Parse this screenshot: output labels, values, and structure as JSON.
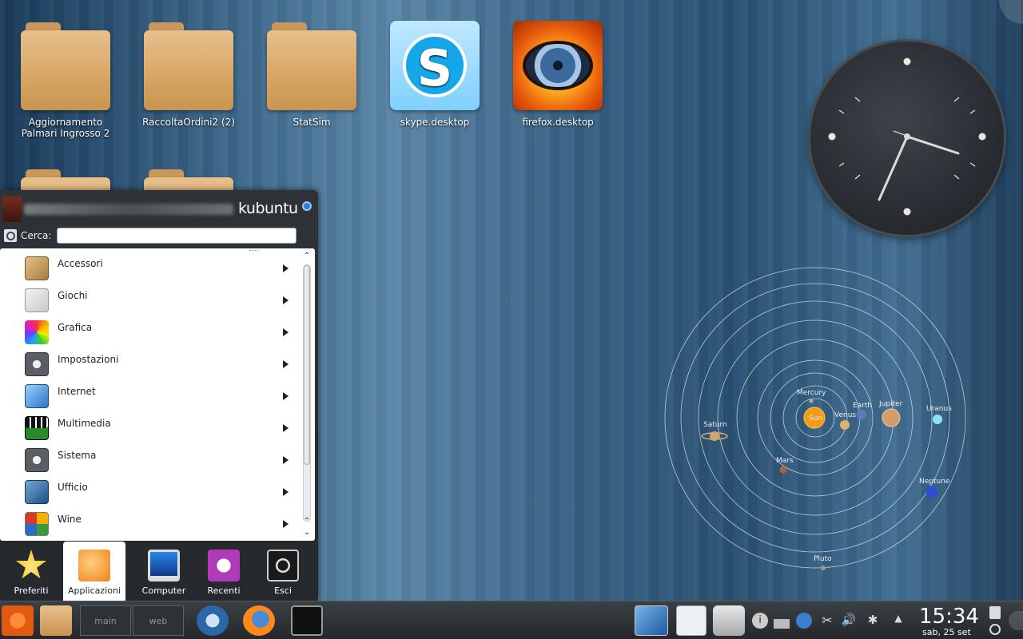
{
  "desktop": {
    "icons": [
      {
        "label": "Aggiornamento Palmari Ingrosso 2",
        "type": "folder"
      },
      {
        "label": "RaccoltaOrdini2 (2)",
        "type": "folder"
      },
      {
        "label": "StatSim",
        "type": "folder"
      },
      {
        "label": "skype.desktop",
        "type": "skype-icon"
      },
      {
        "label": "firefox.desktop",
        "type": "firefox-icon"
      }
    ]
  },
  "clock": {
    "time": "15:34"
  },
  "solar_system": {
    "planets": [
      "Mercury",
      "Venus",
      "Earth",
      "Mars",
      "Jupiter",
      "Saturn",
      "Uranus",
      "Neptune",
      "Pluto"
    ],
    "center": "Sun"
  },
  "launcher": {
    "brand": "kubuntu",
    "search_label": "Cerca:",
    "search_value": "",
    "categories": [
      {
        "label": "Accessori",
        "icon": "calculator-icon",
        "color": "#b88a4a"
      },
      {
        "label": "Giochi",
        "icon": "gamepad-icon",
        "color": "#d8d8d8"
      },
      {
        "label": "Grafica",
        "icon": "color-wheel-icon",
        "color": "#e0407a"
      },
      {
        "label": "Impostazioni",
        "icon": "gears-icon",
        "color": "#555a60"
      },
      {
        "label": "Internet",
        "icon": "globe-icon",
        "color": "#3a86d0"
      },
      {
        "label": "Multimedia",
        "icon": "film-music-icon",
        "color": "#1b1b1b"
      },
      {
        "label": "Sistema",
        "icon": "gears-icon",
        "color": "#555a60"
      },
      {
        "label": "Ufficio",
        "icon": "chart-icon",
        "color": "#2c5e8c"
      },
      {
        "label": "Wine",
        "icon": "windows-icon",
        "color": "#c83a2a"
      }
    ],
    "tabs": [
      {
        "label": "Preferiti",
        "icon": "star-icon"
      },
      {
        "label": "Applicazioni",
        "icon": "applications-icon"
      },
      {
        "label": "Computer",
        "icon": "monitor-icon"
      },
      {
        "label": "Recenti",
        "icon": "recent-icon"
      },
      {
        "label": "Esci",
        "icon": "power-icon"
      }
    ],
    "active_tab": "Applicazioni"
  },
  "taskbar": {
    "pager": [
      "main",
      "web"
    ],
    "time": "15:34",
    "date": "sab, 25 set"
  }
}
